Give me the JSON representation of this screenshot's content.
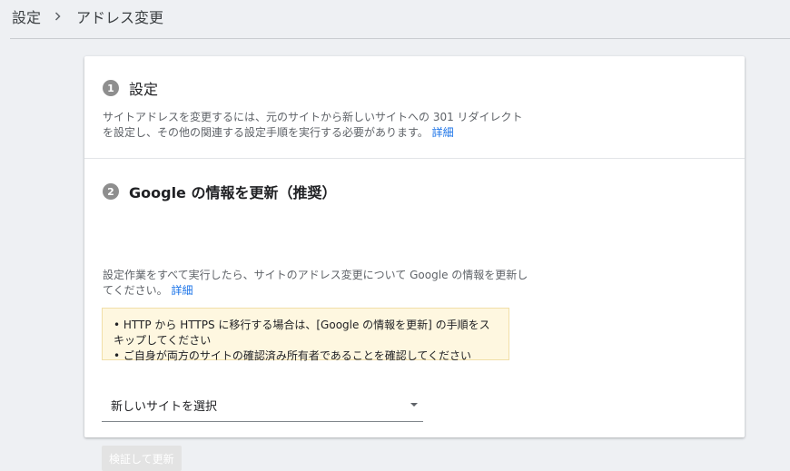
{
  "breadcrumb": {
    "parent": "設定",
    "current": "アドレス変更"
  },
  "steps": [
    {
      "number": "1",
      "title": "設定",
      "description": "サイトアドレスを変更するには、元のサイトから新しいサイトへの 301 リダイレクトを設定し、その他の関連する設定手順を実行する必要があります。",
      "link": "詳細"
    },
    {
      "number": "2",
      "title": "Google の情報を更新（推奨）",
      "description": "設定作業をすべて実行したら、サイトのアドレス変更について Google の情報を更新してください。",
      "link": "詳細",
      "notice": [
        "• HTTP から HTTPS に移行する場合は、[Google の情報を更新] の手順をスキップしてください",
        "• ご自身が両方のサイトの確認済み所有者であることを確認してください"
      ],
      "select_value": "新しいサイトを選択",
      "button_label": "検証して更新"
    }
  ],
  "colors": {
    "background": "#eef0f3",
    "link": "#1a73e8",
    "notice_bg": "#fef7e0",
    "step_badge": "#8e8e8e",
    "disabled_button": "#e3e3e3"
  },
  "icons": {
    "breadcrumb_separator": "chevron-right-icon",
    "dropdown": "caret-down-icon"
  }
}
